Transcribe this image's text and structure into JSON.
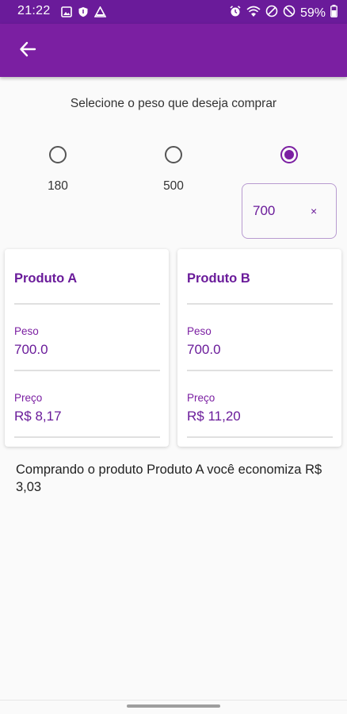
{
  "status_bar": {
    "time": "21:22",
    "battery": "59%",
    "left_icons": [
      "image-icon",
      "shield-icon",
      "warning-icon"
    ],
    "right_icons": [
      "alarm-icon",
      "wifi-icon",
      "dnd-icon",
      "data-saver-icon",
      "battery-icon"
    ]
  },
  "app_bar": {
    "back_icon": "arrow-left-icon",
    "color": "#7b1fa2"
  },
  "selector": {
    "prompt": "Selecione o peso que deseja comprar",
    "options": [
      {
        "label": "180",
        "selected": false
      },
      {
        "label": "500",
        "selected": false
      },
      {
        "label": "",
        "selected": true
      }
    ],
    "custom_value": "700",
    "clear_label": "×"
  },
  "products": [
    {
      "name": "Produto A",
      "peso_label": "Peso",
      "peso_value": "700.0",
      "preco_label": "Preço",
      "preco_value": "R$ 8,17"
    },
    {
      "name": "Produto B",
      "peso_label": "Peso",
      "peso_value": "700.0",
      "preco_label": "Preço",
      "preco_value": "R$ 11,20"
    }
  ],
  "result_text": "Comprando o produto Produto A você economiza R$ 3,03"
}
